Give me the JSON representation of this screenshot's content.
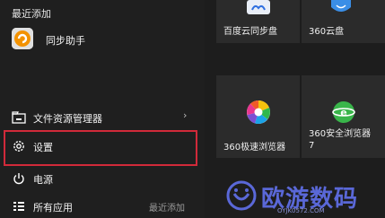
{
  "start_menu": {
    "recent_header": "最近添加",
    "recent_items": [
      {
        "label": "同步助手",
        "icon": "tongbu-app-icon"
      }
    ],
    "side_items": [
      {
        "label": "文件资源管理器",
        "icon": "file-explorer-icon",
        "chevron": "›"
      },
      {
        "label": "设置",
        "icon": "gear-icon"
      },
      {
        "label": "电源",
        "icon": "power-icon"
      },
      {
        "label": "所有应用",
        "icon": "all-apps-icon",
        "hint": "最近添加"
      }
    ]
  },
  "tiles": [
    {
      "label": "百度云同步盘",
      "icon": "baidu-cloud-icon"
    },
    {
      "label": "360云盘",
      "icon": "360-cloud-icon"
    },
    {
      "label": "360极速浏览器",
      "icon": "360-chrome-icon"
    },
    {
      "label_line1": "360安全浏览器",
      "label_line2": "7",
      "icon": "360-safe-browser-icon"
    }
  ],
  "watermark": {
    "title": "欧游数码",
    "url": "OYJK0572.COM"
  },
  "colors": {
    "highlight_border": "#d12a3a",
    "watermark": "#5a68d8"
  }
}
